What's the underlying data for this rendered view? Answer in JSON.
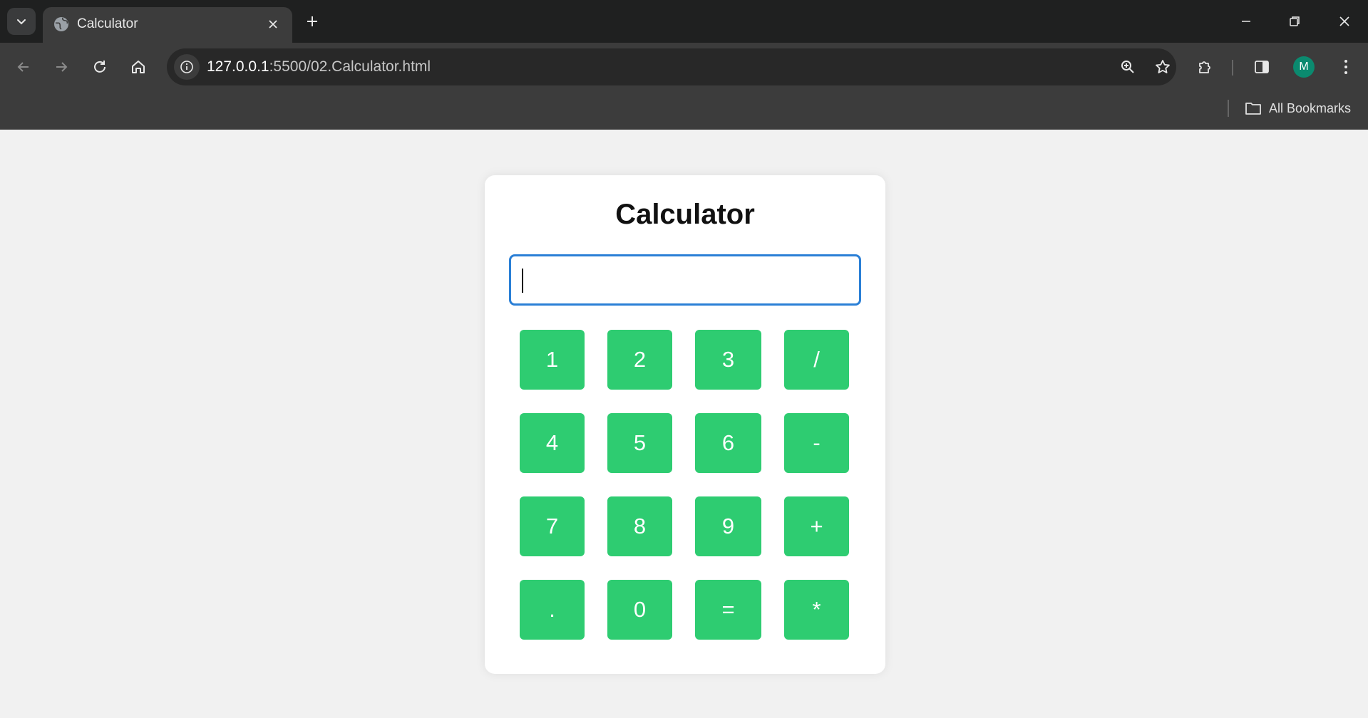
{
  "browser": {
    "tab": {
      "title": "Calculator"
    },
    "address_bar": {
      "url_host": "127.0.0.1",
      "url_rest": ":5500/02.Calculator.html"
    },
    "profile_initial": "M",
    "bookmarks": {
      "all_label": "All Bookmarks"
    }
  },
  "calculator": {
    "title": "Calculator",
    "display_value": "",
    "keys": [
      "1",
      "2",
      "3",
      "/",
      "4",
      "5",
      "6",
      "-",
      "7",
      "8",
      "9",
      "+",
      ".",
      "0",
      "=",
      "*"
    ]
  },
  "colors": {
    "key_bg": "#2ecc71",
    "display_border": "#2a7fd6",
    "page_bg": "#f1f1f1",
    "card_bg": "#ffffff"
  }
}
